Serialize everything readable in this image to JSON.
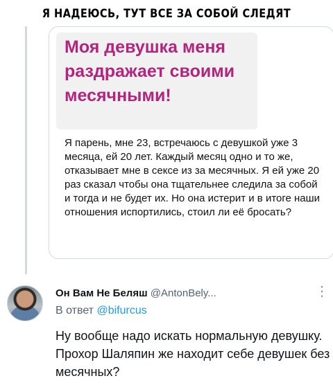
{
  "caption": "Я НАДЕЮСЬ, ТУТ ВСЕ ЗА СОБОЙ СЛЕДЯТ",
  "quoted_post": {
    "headline": "Моя девушка меня раздражает своими месячными!",
    "body": "Я парень, мне 23, встречаюсь с девушкой уже 3 месяца, ей 20 лет. Каждый месяц одно и то же, отказывает мне в сексе из за месячных. Я ей уже 20 раз сказал чтобы она тщательнее следила за собой и тогда и не будет их. Но она истерит и в итоге наши отношения испортились, стоил ли её бросать?"
  },
  "reply": {
    "display_name": "Он Вам Не Беляш",
    "handle": "@AntonBely...",
    "more_icon": "more-vertical-icon",
    "reply_prefix": "В ответ",
    "reply_to": "@bifurcus",
    "text": "Ну вообще надо искать нормальную девушку. Прохор Шаляпин же находит себе девушек без месячных?"
  },
  "colors": {
    "headline": "#b2247e",
    "mention": "#1d9bf0",
    "secondary_text": "#536471"
  }
}
